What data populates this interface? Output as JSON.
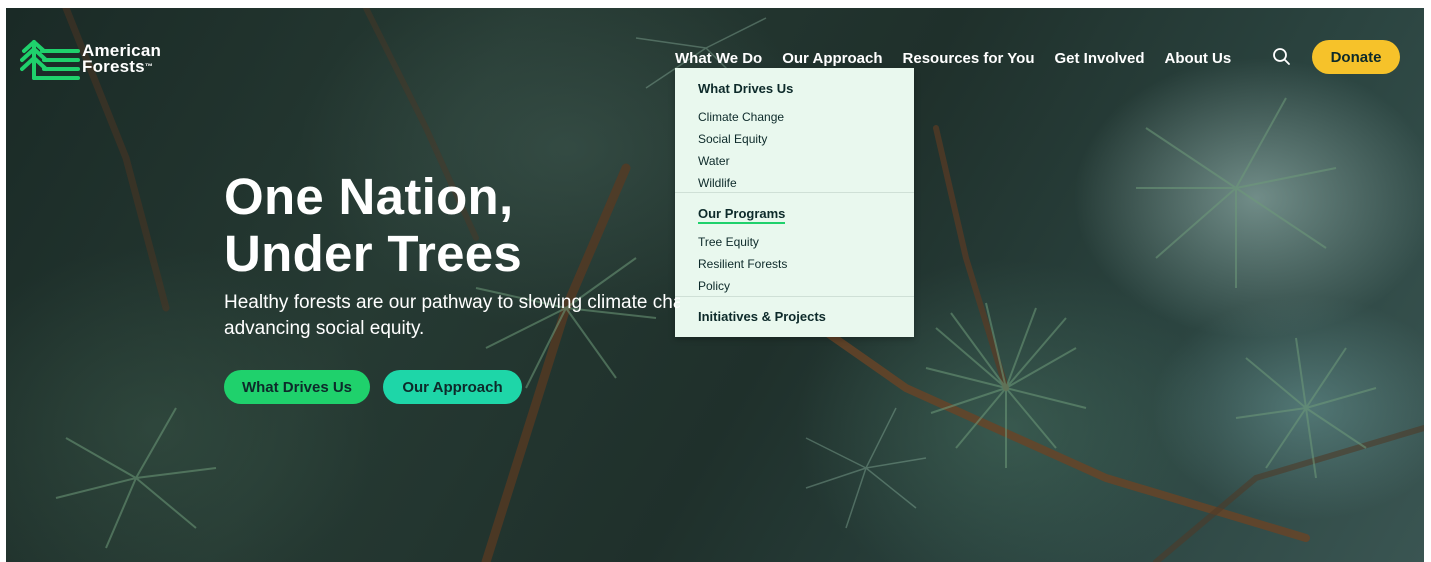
{
  "brand": {
    "line1": "American",
    "line2": "Forests",
    "tm": "™"
  },
  "nav": {
    "items": [
      "What We Do",
      "Our Approach",
      "Resources for You",
      "Get Involved",
      "About Us"
    ],
    "active": "What We Do",
    "search_icon": "search-icon",
    "donate_label": "Donate"
  },
  "dropdown": {
    "sections": [
      {
        "heading": "What Drives Us",
        "links": [
          "Climate Change",
          "Social Equity",
          "Water",
          "Wildlife"
        ]
      },
      {
        "heading": "Our Programs",
        "links": [
          "Tree Equity",
          "Resilient Forests",
          "Policy"
        ]
      },
      {
        "heading": "Initiatives & Projects",
        "links": []
      }
    ]
  },
  "hero": {
    "headline_line1": "One Nation,",
    "headline_line2": "Under Trees",
    "subtext_line1": "Healthy forests are our pathway to slowing climate change and",
    "subtext_line2": "advancing social equity.",
    "cta_primary": "What Drives Us",
    "cta_secondary": "Our Approach"
  },
  "colors": {
    "accent_green": "#1fd16c",
    "accent_teal": "#1ed6a8",
    "donate_yellow": "#f6c22a",
    "dropdown_bg": "#e9f8ee",
    "text_dark": "#0d2a2a"
  }
}
